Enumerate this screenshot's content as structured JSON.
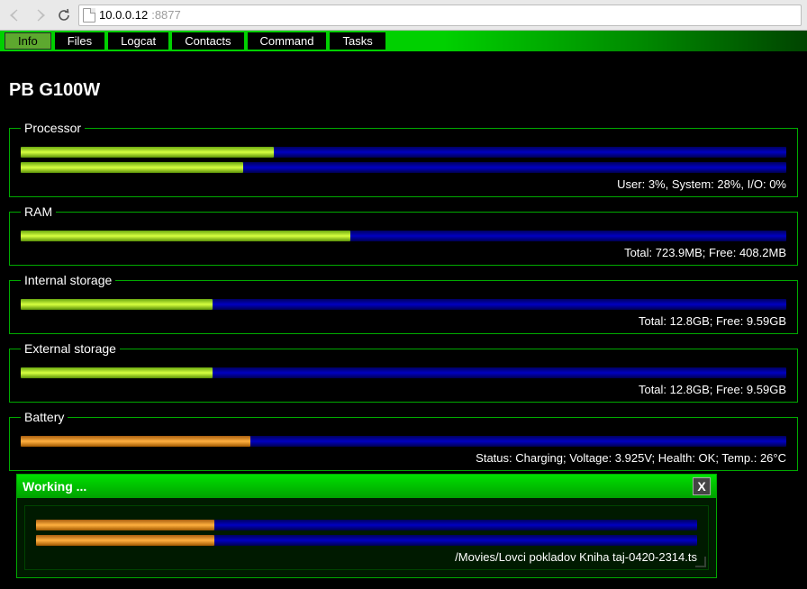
{
  "browser": {
    "address_host": "10.0.0.12",
    "address_port": ":8877"
  },
  "tabs": [
    {
      "label": "Info",
      "active": true
    },
    {
      "label": "Files",
      "active": false
    },
    {
      "label": "Logcat",
      "active": false
    },
    {
      "label": "Contacts",
      "active": false
    },
    {
      "label": "Command",
      "active": false
    },
    {
      "label": "Tasks",
      "active": false
    }
  ],
  "device_title": "PB G100W",
  "processor": {
    "legend": "Processor",
    "bar1_pct": 33,
    "bar2_pct": 29,
    "stats": "User: 3%, System: 28%, I/O: 0%"
  },
  "ram": {
    "legend": "RAM",
    "pct": 43,
    "stats": "Total: 723.9MB; Free: 408.2MB"
  },
  "internal": {
    "legend": "Internal storage",
    "pct": 25,
    "stats": "Total: 12.8GB; Free: 9.59GB"
  },
  "external": {
    "legend": "External storage",
    "pct": 25,
    "stats": "Total: 12.8GB; Free: 9.59GB"
  },
  "battery": {
    "legend": "Battery",
    "pct": 30,
    "stats": "Status: Charging; Voltage: 3.925V; Health: OK; Temp.: 26°C"
  },
  "working": {
    "title": "Working ...",
    "close": "X",
    "bar1_pct": 27,
    "bar2_pct": 27,
    "path": "/Movies/Lovci pokladov Kniha taj-0420-2314.ts"
  }
}
